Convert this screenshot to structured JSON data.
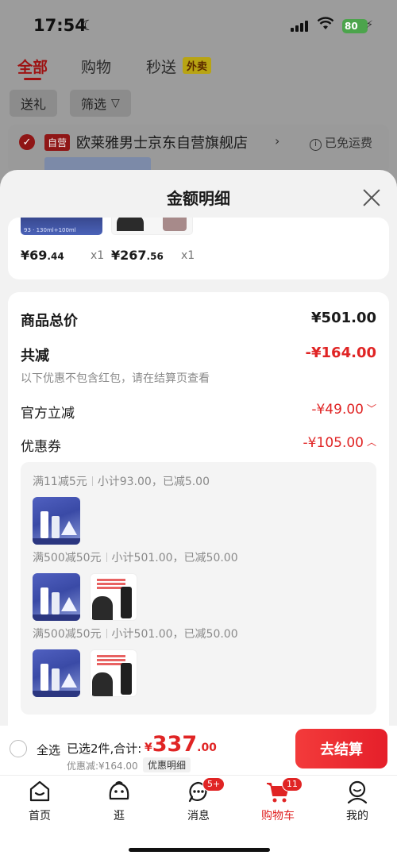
{
  "status": {
    "time": "17:54",
    "battery": "80"
  },
  "topnav": {
    "tabs": [
      "全部",
      "购物",
      "秒送"
    ],
    "waimai_badge": "外卖"
  },
  "filters": {
    "gift": "送礼",
    "filter": "筛选"
  },
  "store": {
    "badge": "自营",
    "name": "欧莱雅男士京东自营旗舰店",
    "shipping": "已免运费"
  },
  "sheet": {
    "title": "金额明细",
    "items": [
      {
        "price_int": "¥69",
        "price_dec": ".44",
        "qty": "x1"
      },
      {
        "price_int": "¥267",
        "price_dec": ".56",
        "qty": "x1"
      }
    ],
    "total_label": "商品总价",
    "total_value": "¥501.00",
    "reduce_label": "共减",
    "reduce_value": "-¥164.00",
    "note": "以下优惠不包含红包，请在结算页查看",
    "official_label": "官方立减",
    "official_value": "-¥49.00",
    "coupon_label": "优惠券",
    "coupon_value": "-¥105.00",
    "coupon_groups": [
      {
        "rule": "满11减5元",
        "detail": "小计93.00，已减5.00"
      },
      {
        "rule": "满500减50元",
        "detail": "小计501.00，已减50.00"
      },
      {
        "rule": "满500减50元",
        "detail": "小计501.00，已减50.00"
      }
    ]
  },
  "checkout": {
    "select_all": "全选",
    "summary": "已选2件,合计:",
    "yen": "¥",
    "total_int": "337",
    "total_dec": ".00",
    "discount": "优惠减:¥164.00",
    "detail_btn": "优惠明细",
    "pay_btn": "去结算"
  },
  "tabbar": {
    "items": [
      "首页",
      "逛",
      "消息",
      "购物车",
      "我的"
    ],
    "msg_badge": "5+",
    "cart_badge": "11"
  },
  "colors": {
    "accent": "#e02424",
    "checkout_btn": "#f33b3b"
  }
}
